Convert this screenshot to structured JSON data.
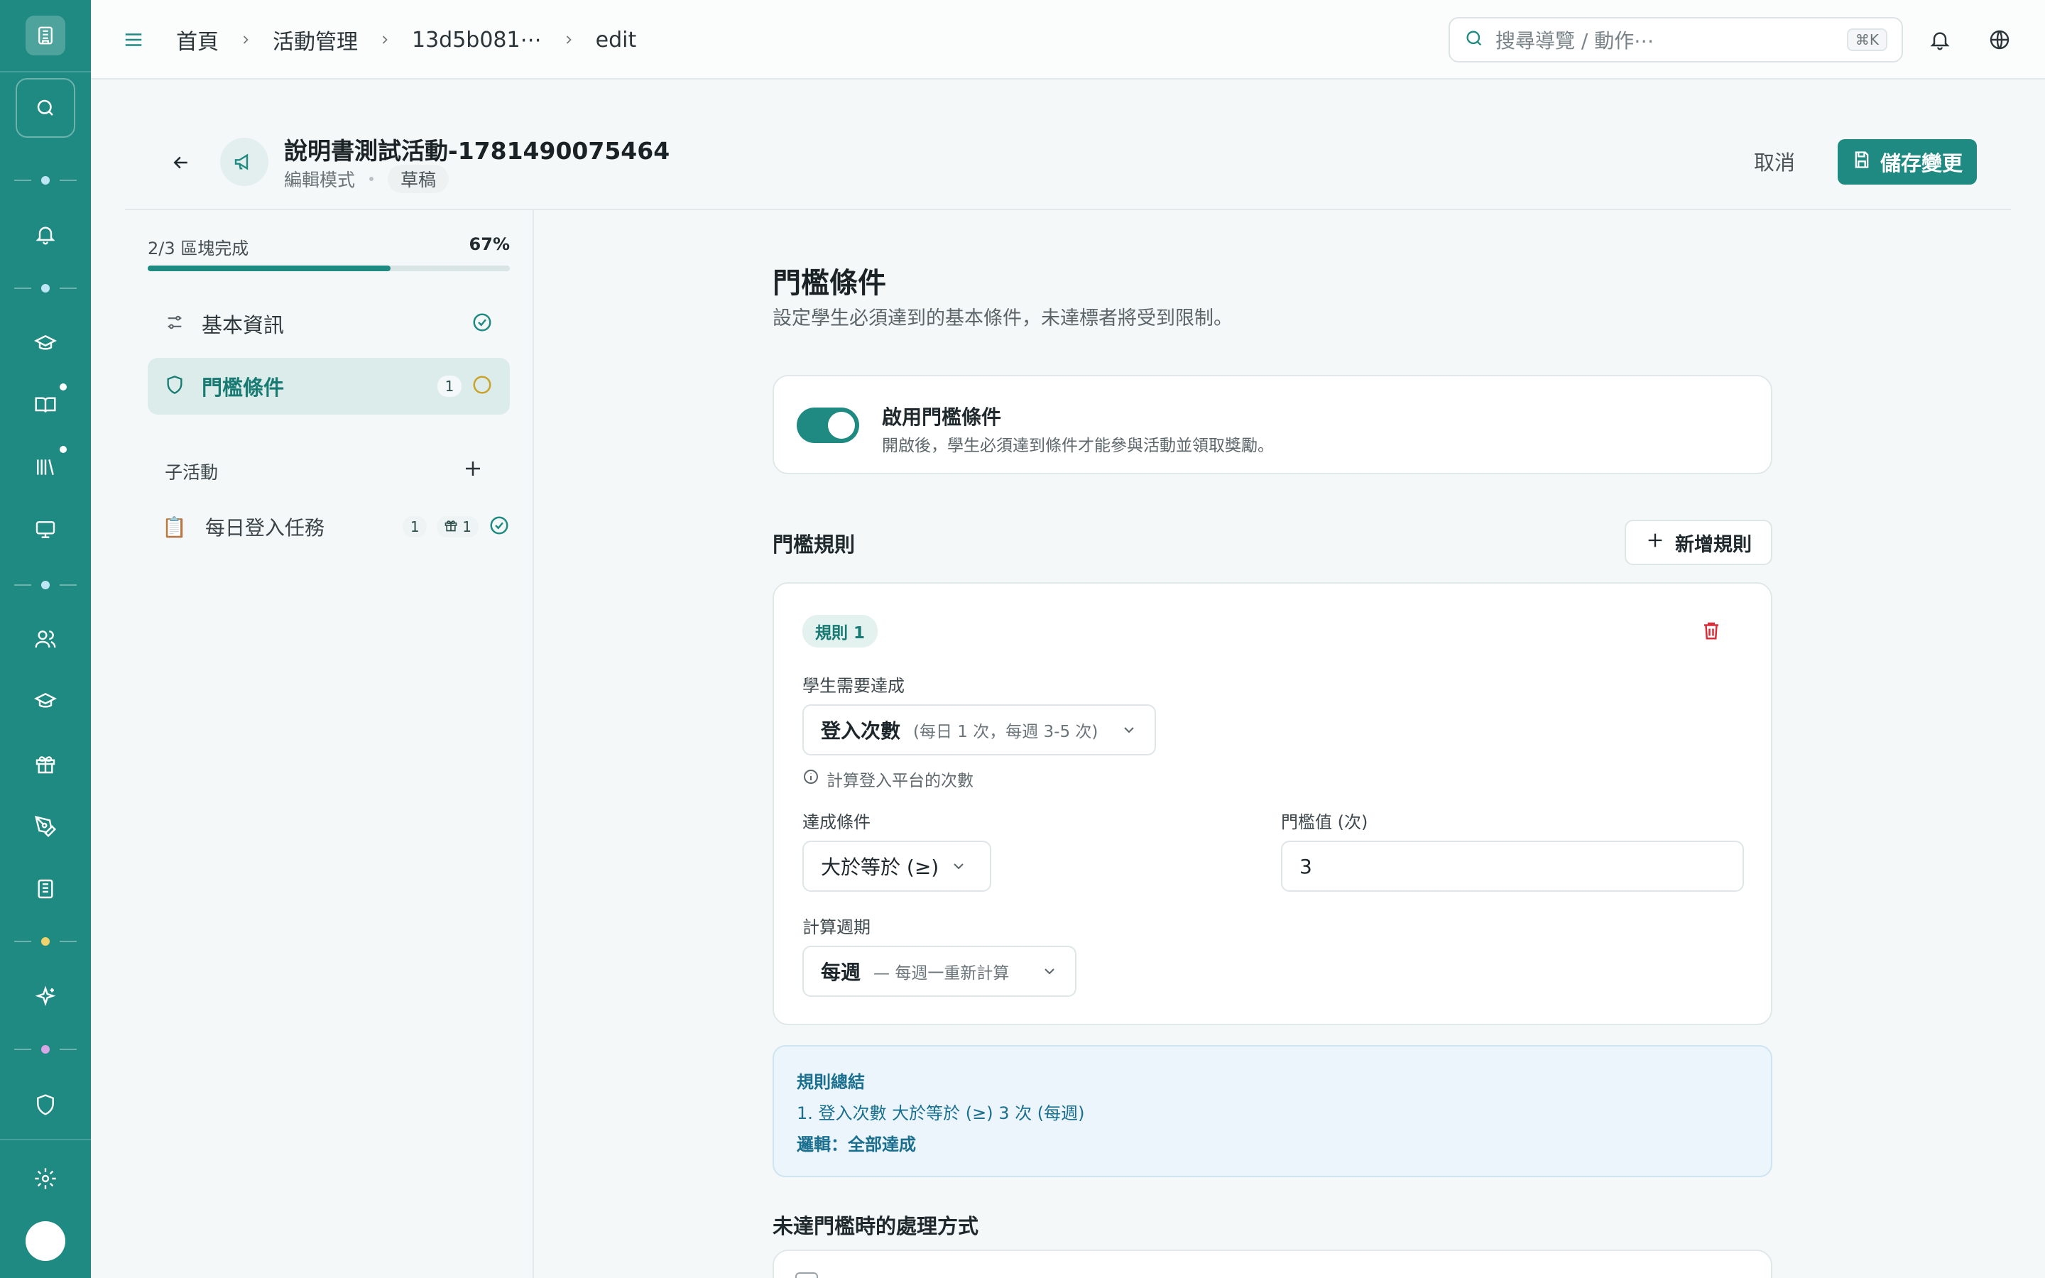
{
  "topbar": {
    "breadcrumbs": [
      "首頁",
      "活動管理",
      "13d5b081⋯",
      "edit"
    ],
    "search_placeholder": "搜尋導覽 / 動作⋯",
    "search_shortcut": "⌘K"
  },
  "header": {
    "title": "說明書測試活動-1781490075464",
    "mode": "編輯模式",
    "status": "草稿",
    "cancel_label": "取消",
    "save_label": "儲存變更"
  },
  "sidebar": {
    "progress_label": "2/3 區塊完成",
    "progress_percent": "67%",
    "progress_value": 0.67,
    "sections": [
      {
        "label": "基本資訊",
        "icon": "sliders-icon",
        "status": "complete"
      },
      {
        "label": "門檻條件",
        "icon": "shield-icon",
        "count": "1",
        "status": "pending"
      }
    ],
    "sub_heading": "子活動",
    "sub_items": [
      {
        "icon": "📋",
        "label": "每日登入任務",
        "count": "1",
        "gift_count": "1",
        "status": "complete"
      }
    ]
  },
  "main": {
    "title": "門檻條件",
    "description": "設定學生必須達到的基本條件，未達標者將受到限制。",
    "toggle": {
      "title": "啟用門檻條件",
      "description": "開啟後，學生必須達到條件才能參與活動並領取獎勵。",
      "enabled": true
    },
    "rules_title": "門檻規則",
    "add_rule_label": "新增規則",
    "rule": {
      "badge": "規則 1",
      "metric_label": "學生需要達成",
      "metric_value": "登入次數",
      "metric_hint": "(每日 1 次，每週 3-5 次)",
      "metric_info": "計算登入平台的次數",
      "condition_label": "達成條件",
      "condition_value": "大於等於 (≥)",
      "threshold_label": "門檻值 (次)",
      "threshold_value": "3",
      "period_label": "計算週期",
      "period_value": "每週",
      "period_hint": "— 每週一重新計算"
    },
    "summary": {
      "title": "規則總結",
      "line": "1. 登入次數 大於等於 (≥) 3 次 (每週)",
      "logic": "邏輯：全部達成"
    },
    "unmet_title": "未達門檻時的處理方式"
  },
  "colors": {
    "brand": "#1e8a82",
    "danger": "#d92d3a",
    "pending": "#c9a227",
    "summary_text": "#1a6f8f"
  }
}
